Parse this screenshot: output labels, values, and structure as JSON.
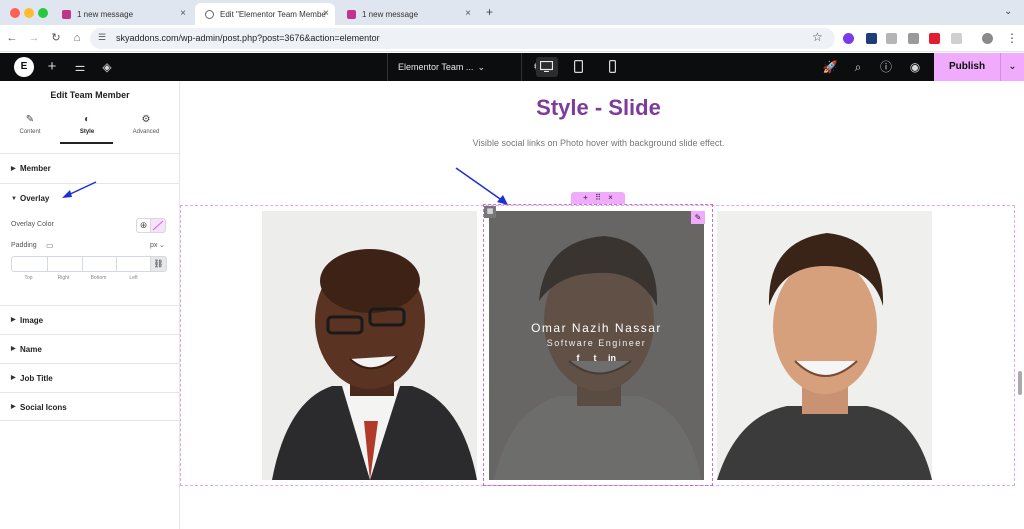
{
  "browser": {
    "tabs": [
      {
        "title": "1 new message"
      },
      {
        "title": "Edit \"Elementor Team Membe"
      },
      {
        "title": "1 new message"
      }
    ],
    "new_tab": "+",
    "url": "skyaddons.com/wp-admin/post.php?post=3676&action=elementor",
    "menu_glyph": "⋮",
    "expand_glyph": "⌄"
  },
  "editor_toolbar": {
    "logo": "E",
    "doc_title": "Elementor Team ...",
    "publish_label": "Publish"
  },
  "panel": {
    "title": "Edit Team Member",
    "tabs": [
      "Content",
      "Style",
      "Advanced"
    ],
    "sections": {
      "member": "Member",
      "overlay": "Overlay",
      "image": "Image",
      "name": "Name",
      "job_title": "Job Title",
      "social_icons": "Social Icons"
    },
    "overlay_color_label": "Overlay Color",
    "padding_label": "Padding",
    "padding_unit": "px",
    "dimensions": [
      "Top",
      "Right",
      "Bottom",
      "Left"
    ]
  },
  "page": {
    "heading": "Style - Slide",
    "subtitle": "Visible social links on Photo hover with background slide effect.",
    "member": {
      "name": "Omar Nazih Nassar",
      "job_title": "Software Engineer",
      "social": [
        "f",
        "t",
        "in"
      ]
    }
  },
  "colors": {
    "accent": "#f0abfc",
    "heading": "#7e3b9a",
    "annotation_arrow": "#1a2fd6",
    "toolbar_bg": "#0c0d0e"
  }
}
